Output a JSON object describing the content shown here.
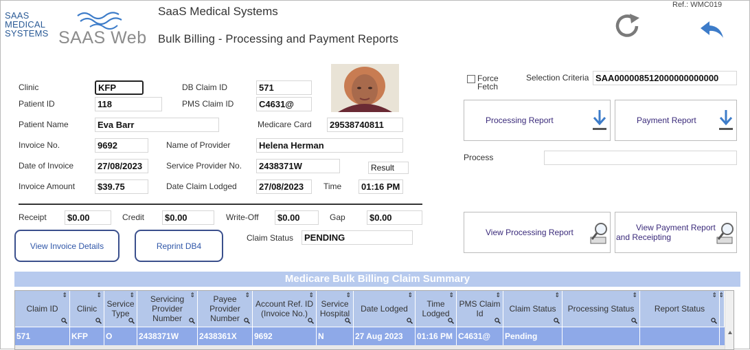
{
  "header": {
    "logo_lines": [
      "SAAS",
      "MEDICAL",
      "SYSTEMS"
    ],
    "logo_web": "SAAS Web",
    "company": "SaaS Medical Systems",
    "subtitle": "Bulk Billing - Processing and Payment Reports",
    "ref": "Ref.: WMC019"
  },
  "form": {
    "clinic": {
      "label": "Clinic",
      "value": "KFP"
    },
    "patient_id": {
      "label": "Patient ID",
      "value": "118"
    },
    "patient_name": {
      "label": "Patient Name",
      "value": "Eva Barr"
    },
    "invoice_no": {
      "label": "Invoice No.",
      "value": "9692"
    },
    "date_of_invoice": {
      "label": "Date of Invoice",
      "value": "27/08/2023"
    },
    "invoice_amount": {
      "label": "Invoice Amount",
      "value": "$39.75"
    },
    "db_claim_id": {
      "label": "DB Claim ID",
      "value": "571"
    },
    "pms_claim_id": {
      "label": "PMS Claim ID",
      "value": "C4631@"
    },
    "medicare_card": {
      "label": "Medicare Card",
      "value": "29538740811"
    },
    "name_of_provider": {
      "label": "Name of Provider",
      "value": "Helena Herman"
    },
    "service_provider_no": {
      "label": "Service Provider No.",
      "value": "2438371W"
    },
    "date_claim_lodged": {
      "label": "Date Claim Lodged",
      "value": "27/08/2023"
    },
    "time": {
      "label": "Time",
      "value": "01:16 PM"
    },
    "result": {
      "value": "Result"
    },
    "receipt": {
      "label": "Receipt",
      "value": "$0.00"
    },
    "credit": {
      "label": "Credit",
      "value": "$0.00"
    },
    "write_off": {
      "label": "Write-Off",
      "value": "$0.00"
    },
    "gap": {
      "label": "Gap",
      "value": "$0.00"
    },
    "claim_status": {
      "label": "Claim Status",
      "value": "PENDING"
    }
  },
  "buttons": {
    "view_invoice_details": "View Invoice Details",
    "reprint_db4": "Reprint DB4",
    "processing_report": "Processing Report",
    "payment_report": "Payment Report",
    "view_processing_report": "View Processing Report",
    "view_payment_report_line1": "View Payment Report",
    "view_payment_report_line2": "and Receipting"
  },
  "right_panel": {
    "force_fetch_line1": "Force",
    "force_fetch_line2": "Fetch",
    "force_fetch_checked": false,
    "selection_criteria_label": "Selection Criteria",
    "selection_criteria_value": "SAA000008512000000000000",
    "process_label": "Process",
    "process_value": ""
  },
  "grid": {
    "title": "Medicare Bulk Billing Claim Summary",
    "columns": [
      "Claim ID",
      "Clinic",
      "Service Type",
      "Servicing Provider Number",
      "Payee Provider Number",
      "Account Ref. ID (Invoice No.)",
      "Service Hospital",
      "Date Lodged",
      "Time Lodged",
      "PMS Claim Id",
      "Claim Status",
      "Processing Status",
      "Report Status"
    ],
    "rows": [
      [
        "571",
        "KFP",
        "O",
        "2438371W",
        "2438361X",
        "9692",
        "N",
        "27 Aug 2023",
        "01:16 PM",
        "C4631@",
        "Pending",
        "",
        ""
      ]
    ]
  },
  "colors": {
    "accent": "#3a4f8c",
    "grid_header": "#b4c7ea",
    "grid_title": "#b7caee",
    "row_selected": "#8ea9e8",
    "icon_blue": "#3d7cc9"
  }
}
